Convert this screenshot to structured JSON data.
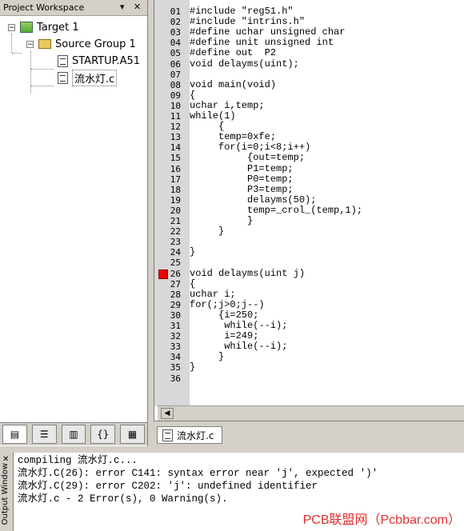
{
  "workspace": {
    "title": "Project Workspace",
    "ctl_pin": "▾",
    "ctl_close": "✕",
    "tree": {
      "target": "Target 1",
      "group": "Source Group 1",
      "files": [
        "STARTUP.A51",
        "流水灯.c"
      ]
    },
    "tabs": [
      "▤",
      "☰",
      "▥",
      "{}",
      "▦"
    ]
  },
  "editor": {
    "tab_label": "流水灯.c",
    "breakpoint_line": 26,
    "lines": [
      {
        "n": "01",
        "t": "#include \"reg51.h\""
      },
      {
        "n": "02",
        "t": "#include \"intrins.h\""
      },
      {
        "n": "03",
        "t": "#define uchar unsigned char"
      },
      {
        "n": "04",
        "t": "#define unit unsigned int"
      },
      {
        "n": "05",
        "t": "#define out  P2"
      },
      {
        "n": "06",
        "t": "void delayms(uint);"
      },
      {
        "n": "07",
        "t": ""
      },
      {
        "n": "08",
        "t": "void main(void)"
      },
      {
        "n": "09",
        "t": "{"
      },
      {
        "n": "10",
        "t": "uchar i,temp;"
      },
      {
        "n": "11",
        "t": "while(1)"
      },
      {
        "n": "12",
        "t": "     {"
      },
      {
        "n": "13",
        "t": "     temp=0xfe;"
      },
      {
        "n": "14",
        "t": "     for(i=0;i<8;i++)"
      },
      {
        "n": "15",
        "t": "          {out=temp;"
      },
      {
        "n": "16",
        "t": "          P1=temp;"
      },
      {
        "n": "17",
        "t": "          P0=temp;"
      },
      {
        "n": "18",
        "t": "          P3=temp;"
      },
      {
        "n": "19",
        "t": "          delayms(50);"
      },
      {
        "n": "20",
        "t": "          temp=_crol_(temp,1);"
      },
      {
        "n": "21",
        "t": "          }"
      },
      {
        "n": "22",
        "t": "     }"
      },
      {
        "n": "23",
        "t": ""
      },
      {
        "n": "24",
        "t": "}"
      },
      {
        "n": "25",
        "t": ""
      },
      {
        "n": "26",
        "t": "void delayms(uint j)"
      },
      {
        "n": "27",
        "t": "{"
      },
      {
        "n": "28",
        "t": "uchar i;"
      },
      {
        "n": "29",
        "t": "for(;j>0;j--)"
      },
      {
        "n": "30",
        "t": "     {i=250;"
      },
      {
        "n": "31",
        "t": "      while(--i);"
      },
      {
        "n": "32",
        "t": "      i=249;"
      },
      {
        "n": "33",
        "t": "      while(--i);"
      },
      {
        "n": "34",
        "t": "     }"
      },
      {
        "n": "35",
        "t": "}"
      },
      {
        "n": "36",
        "t": ""
      }
    ]
  },
  "output": {
    "side_label": "Output Window",
    "close": "✕",
    "lines": [
      "compiling 流水灯.c...",
      "流水灯.C(26): error C141: syntax error near 'j', expected ')'",
      "流水灯.C(29): error C202: 'j': undefined identifier",
      "流水灯.c - 2 Error(s), 0 Warning(s)."
    ]
  },
  "watermark": "PCB联盟网（Pcbbar.com）",
  "colors": {
    "breakpoint": "#ee0000",
    "keyword": "#000000",
    "string": "#a000a0",
    "number": "#a000a0"
  }
}
